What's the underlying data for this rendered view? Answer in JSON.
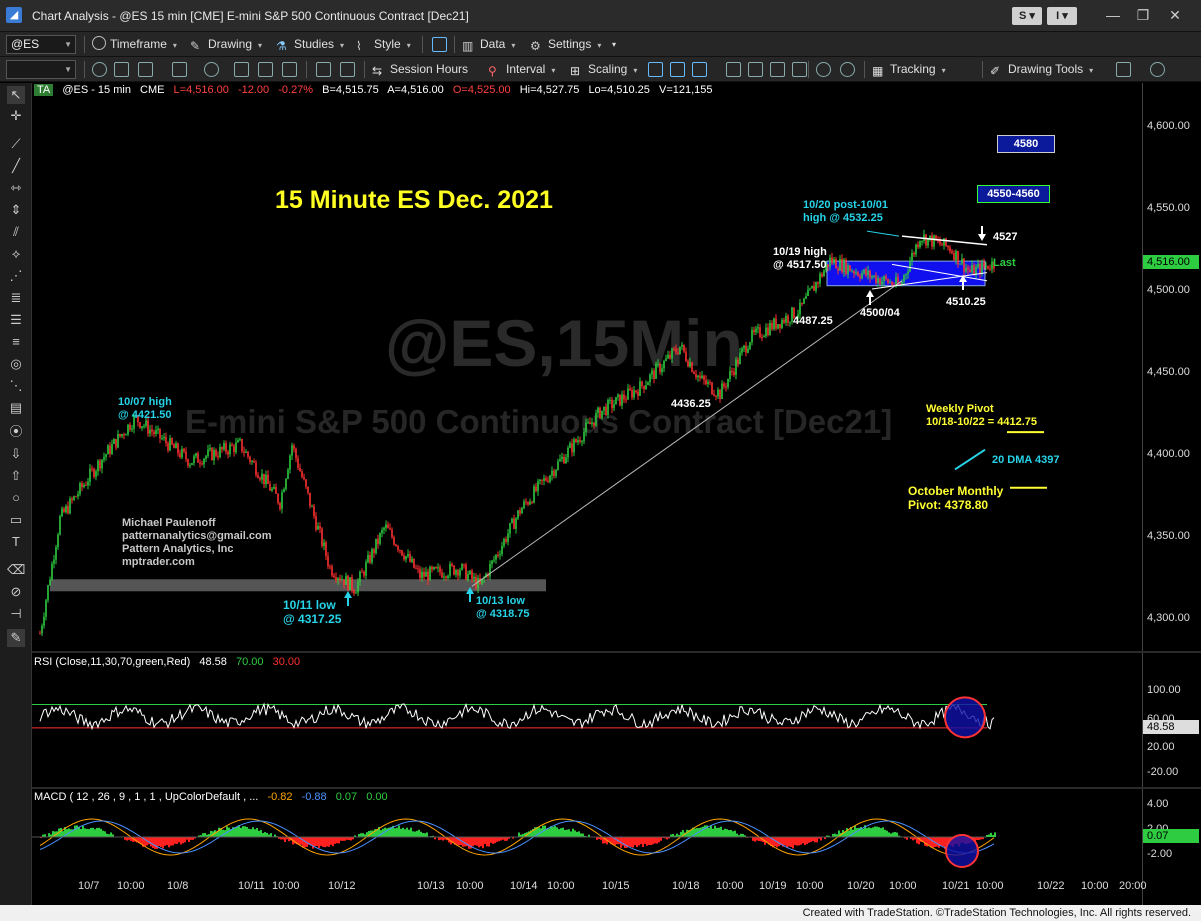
{
  "window": {
    "title": "Chart Analysis - @ES 15 min [CME] E-mini S&P 500 Continuous Contract [Dec21]",
    "s_button": "S",
    "i_button": "I"
  },
  "toolbar1": {
    "symbol": "@ES",
    "timeframe": "Timeframe",
    "drawing": "Drawing",
    "studies": "Studies",
    "style": "Style",
    "data": "Data",
    "settings": "Settings"
  },
  "toolbar2": {
    "session_hours": "Session Hours",
    "interval": "Interval",
    "scaling": "Scaling",
    "tracking": "Tracking",
    "drawing_tools": "Drawing Tools"
  },
  "header": {
    "ta": "TA",
    "symbol": "@ES - 15 min",
    "exchange": "CME",
    "last": "L=4,516.00",
    "change": "-12.00",
    "pct": "-0.27%",
    "bid": "B=4,515.75",
    "ask": "A=4,516.00",
    "open": "O=4,525.00",
    "high": "Hi=4,527.75",
    "low": "Lo=4,510.25",
    "volume": "V=121,155"
  },
  "annotations": {
    "title": "15 Minute ES Dec. 2021",
    "watermark_symbol": "@ES,15Min",
    "watermark_name": "E-mini S&P 500 Continuous Contract [Dec21]",
    "high_1007_a": "10/07 high",
    "high_1007_b": "@ 4421.50",
    "author1": "Michael Paulenoff",
    "author2": "patternanalytics@gmail.com",
    "author3": "Pattern Analytics, Inc",
    "author4": "mptrader.com",
    "low_1011_a": "10/11 low",
    "low_1011_b": "@ 4317.25",
    "low_1013_a": "10/13 low",
    "low_1013_b": "@ 4318.75",
    "lvl_4436": "4436.25",
    "lvl_4487": "4487.25",
    "high_1019_a": "10/19 high",
    "high_1019_b": "@ 4517.50",
    "high_1020_a": "10/20 post-10/01",
    "high_1020_b": "high @ 4532.25",
    "lvl_4500": "4500/04",
    "lvl_4510": "4510.25",
    "lvl_4527": "4527",
    "last": "Last",
    "box_4580": "4580",
    "box_4550": "4550-4560",
    "weekly_a": "Weekly Pivot",
    "weekly_b": "10/18-10/22 = 4412.75",
    "dma": "20 DMA 4397",
    "monthly_a": "October Monthly",
    "monthly_b": "Pivot: 4378.80"
  },
  "price_axis": {
    "labels": [
      "4,600.00",
      "4,550.00",
      "4,500.00",
      "4,450.00",
      "4,400.00",
      "4,350.00",
      "4,300.00"
    ],
    "last_price": "4,516.00"
  },
  "rsi": {
    "label": "RSI (Close,11,30,70,green,Red)",
    "value": "48.58",
    "overbought": "70.00",
    "oversold": "30.00",
    "axis": [
      "100.00",
      "60.00",
      "20.00",
      "-20.00"
    ]
  },
  "macd": {
    "label": "MACD ( 12 , 26 , 9 , 1 , 1 , UpColorDefault , ...",
    "v1": "-0.82",
    "v2": "-0.88",
    "v3": "0.07",
    "v4": "0.00",
    "axis": [
      "4.00",
      "2.00",
      "-2.00"
    ],
    "last": "0.07"
  },
  "time_axis": [
    "10/7",
    "10:00",
    "10/8",
    "10/11",
    "10:00",
    "10/12",
    "10/13",
    "10:00",
    "10/14",
    "10:00",
    "10/15",
    "10/18",
    "10:00",
    "10/19",
    "10:00",
    "10/20",
    "10:00",
    "10/21",
    "10:00",
    "10/22",
    "10:00",
    "20:00"
  ],
  "status": "Created with TradeStation. ©TradeStation Technologies, Inc. All rights reserved.",
  "colors": {
    "up_candle": "#2ecc40",
    "down_candle": "#ff3030",
    "annotation_cyan": "#27d3e8",
    "title_yellow": "#ffff22",
    "channel_blue": "#1010ee"
  },
  "chart_data": {
    "type": "candlestick",
    "interval": "15 min",
    "ylim": [
      4275,
      4610
    ],
    "key_prices": [
      {
        "label": "10/07 high",
        "value": 4421.5
      },
      {
        "label": "10/11 low",
        "value": 4317.25
      },
      {
        "label": "10/13 low",
        "value": 4318.75
      },
      {
        "label": "4436.25",
        "value": 4436.25
      },
      {
        "label": "4487.25",
        "value": 4487.25
      },
      {
        "label": "10/19 high",
        "value": 4517.5
      },
      {
        "label": "10/20 post-10/01 high",
        "value": 4532.25
      },
      {
        "label": "4500/04",
        "value": 4502
      },
      {
        "label": "4510.25",
        "value": 4510.25
      },
      {
        "label": "4527",
        "value": 4527
      },
      {
        "label": "Weekly Pivot",
        "value": 4412.75
      },
      {
        "label": "20 DMA",
        "value": 4397
      },
      {
        "label": "October Monthly Pivot",
        "value": 4378.8
      }
    ],
    "path": [
      [
        0,
        4290
      ],
      [
        20,
        4360
      ],
      [
        60,
        4395
      ],
      [
        95,
        4421.5
      ],
      [
        150,
        4395
      ],
      [
        200,
        4405
      ],
      [
        240,
        4370
      ],
      [
        252,
        4405
      ],
      [
        290,
        4330
      ],
      [
        315,
        4317.25
      ],
      [
        345,
        4355
      ],
      [
        380,
        4325
      ],
      [
        420,
        4330
      ],
      [
        440,
        4318.75
      ],
      [
        480,
        4365
      ],
      [
        520,
        4395
      ],
      [
        560,
        4425
      ],
      [
        600,
        4440
      ],
      [
        640,
        4465
      ],
      [
        660,
        4445
      ],
      [
        680,
        4436.25
      ],
      [
        710,
        4470
      ],
      [
        760,
        4487.25
      ],
      [
        790,
        4517.5
      ],
      [
        820,
        4510
      ],
      [
        860,
        4502
      ],
      [
        880,
        4532.25
      ],
      [
        910,
        4525
      ],
      [
        930,
        4510.25
      ],
      [
        955,
        4516
      ]
    ]
  }
}
